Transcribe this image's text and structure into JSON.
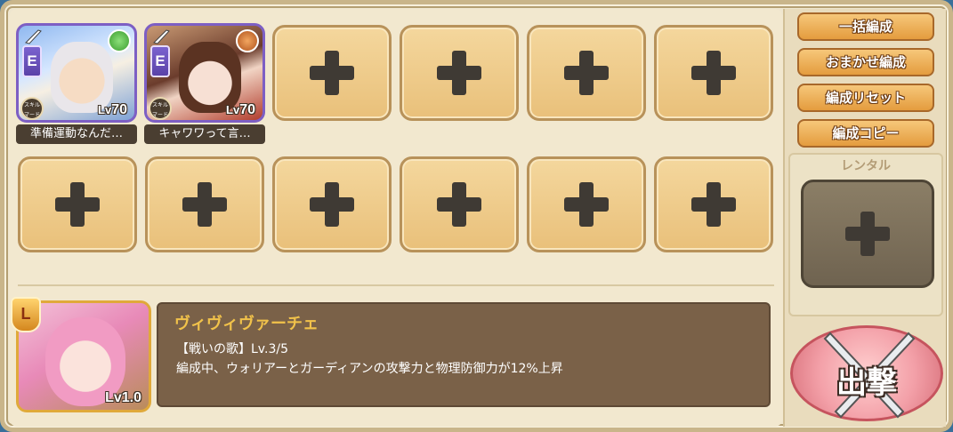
{
  "party": {
    "units": [
      {
        "rarity": "E",
        "level_prefix": "Lv",
        "level": "70",
        "name": "準備運動なんだ…",
        "element": "wind",
        "skill_badge": "スキル\nマード",
        "colors": {
          "frame": "#7d5fc4"
        }
      },
      {
        "rarity": "E",
        "level_prefix": "Lv",
        "level": "70",
        "name": "キャワワって言…",
        "element": "fire",
        "skill_badge": "スキル\nマード",
        "colors": {
          "frame": "#7d5fc4"
        }
      }
    ],
    "empty_slot_icon": "plus-icon"
  },
  "side_buttons": {
    "bulk": "一括編成",
    "auto": "おまかせ編成",
    "reset": "編成リセット",
    "copy": "編成コピー"
  },
  "rental": {
    "title": "レンタル"
  },
  "leader": {
    "badge": "L",
    "level_prefix": "Lv",
    "level": "1.0",
    "name": "ヴィヴィヴァーチェ",
    "skill_line1": "【戦いの歌】Lv.3/5",
    "skill_line2": "編成中、ウォリアーとガーディアンの攻撃力と物理防御力が12%上昇"
  },
  "sortie": {
    "label": "出撃"
  },
  "colors": {
    "slot_fill": "#f0cd8c",
    "button_orange": "#e49c3e",
    "skill_name": "#f1c24a",
    "panel_brown": "#7a6148"
  }
}
